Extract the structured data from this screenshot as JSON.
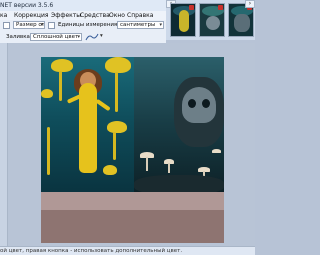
{
  "window": {
    "title": "NET версии 3.5.6"
  },
  "menu": {
    "items": [
      "ка",
      "Коррекция",
      "Эффекты",
      "Средства",
      "Окно",
      "Справка"
    ]
  },
  "toolbar": {
    "size_label": "Размер ст",
    "units_label": "Единицы измерения:",
    "units_value": "сантиметры",
    "fill_label": "Заливка:",
    "fill_value": "Сплошной цвет"
  },
  "status": {
    "text": "ой цвет, правая кнопка - использовать дополнительный цвет."
  },
  "colors": {
    "accent": "#dfe9f6",
    "workspace": "#b8c4d6",
    "canvas_bottom": "#9c8684"
  },
  "tabs": {
    "count": 3,
    "prev_label": "‹",
    "next_label": "›"
  }
}
